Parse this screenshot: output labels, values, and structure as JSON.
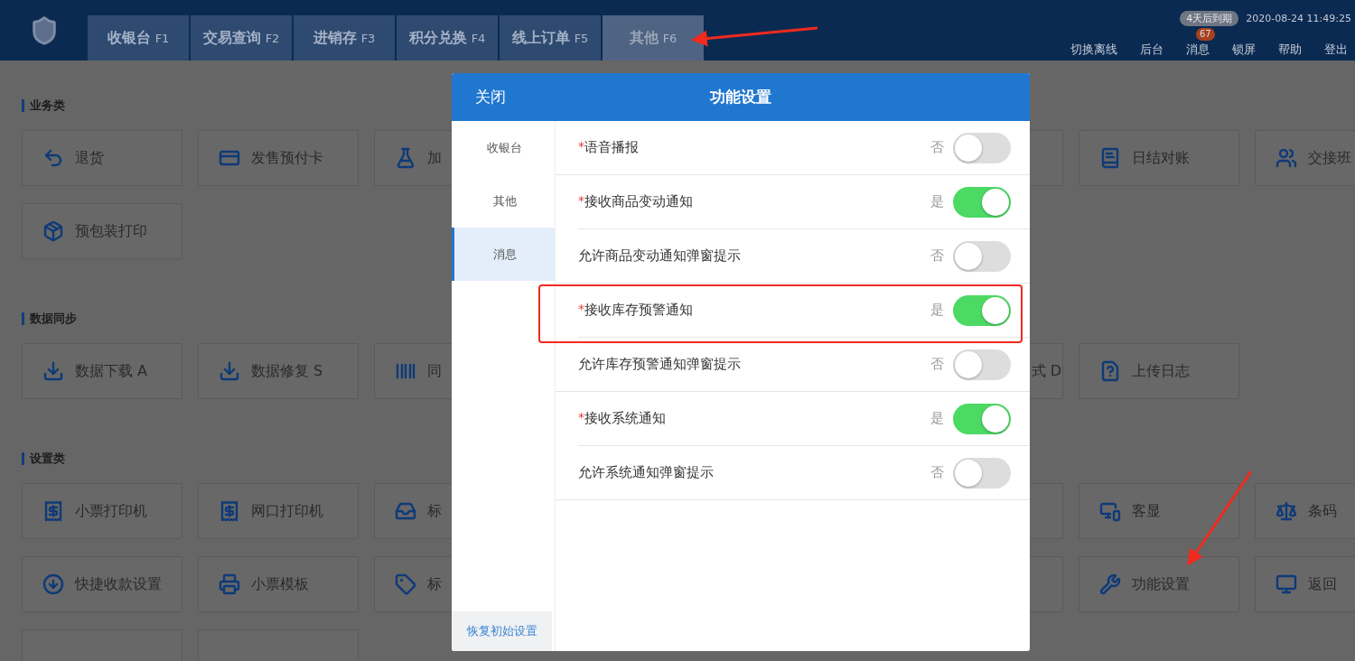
{
  "header": {
    "tabs": [
      {
        "label": "收银台",
        "key": "F1",
        "selected": false
      },
      {
        "label": "交易查询",
        "key": "F2",
        "selected": false
      },
      {
        "label": "进销存",
        "key": "F3",
        "selected": false
      },
      {
        "label": "积分兑换",
        "key": "F4",
        "selected": false
      },
      {
        "label": "线上订单",
        "key": "F5",
        "selected": false
      },
      {
        "label": "其他",
        "key": "F6",
        "selected": true
      }
    ],
    "expiry_badge": "4天后到期",
    "datetime": "2020-08-24 11:49:25",
    "links": [
      {
        "label": "切换离线"
      },
      {
        "label": "后台"
      },
      {
        "label": "消息",
        "badge": "67"
      },
      {
        "label": "锁屏"
      },
      {
        "label": "帮助"
      },
      {
        "label": "登出"
      }
    ]
  },
  "sections": [
    {
      "title": "业务类",
      "rows": [
        {
          "left": [
            {
              "label": "退货"
            },
            {
              "label": "发售预付卡"
            },
            {
              "label": "加"
            }
          ],
          "right": [
            {
              "kind": "blank"
            },
            {
              "label": "日结对账"
            },
            {
              "label": "交接班"
            }
          ]
        },
        {
          "left": [
            {
              "label": "预包装打印"
            }
          ],
          "right": []
        }
      ]
    },
    {
      "title": "数据同步",
      "rows": [
        {
          "left": [
            {
              "label": "数据下载 A"
            },
            {
              "label": "数据修复 S"
            },
            {
              "label": "同"
            }
          ],
          "right": [
            {
              "label": "式 D",
              "kind": "cut"
            },
            {
              "label": "上传日志"
            }
          ]
        }
      ]
    },
    {
      "title": "设置类",
      "rows": [
        {
          "left": [
            {
              "label": "小票打印机"
            },
            {
              "label": "网口打印机"
            },
            {
              "label": "标"
            }
          ],
          "right": [
            {
              "kind": "blank"
            },
            {
              "label": "客显"
            },
            {
              "label": "条码"
            }
          ]
        },
        {
          "left": [
            {
              "label": "快捷收款设置"
            },
            {
              "label": "小票模板"
            },
            {
              "label": "标"
            }
          ],
          "right": [
            {
              "kind": "blank"
            },
            {
              "label": "功能设置"
            },
            {
              "label": "返回"
            }
          ]
        },
        {
          "left": [
            {
              "kind": "blank"
            },
            {
              "kind": "blank"
            }
          ],
          "right": []
        }
      ]
    }
  ],
  "dialog": {
    "close": "关闭",
    "title": "功能设置",
    "nav": [
      {
        "label": "收银台",
        "selected": false
      },
      {
        "label": "其他",
        "selected": false
      },
      {
        "label": "消息",
        "selected": true
      }
    ],
    "reset": "恢复初始设置",
    "groups": [
      [
        {
          "marker": "*",
          "label": "语音播报",
          "value": "否",
          "on": false
        }
      ],
      [
        {
          "marker": "*",
          "label": "接收商品变动通知",
          "value": "是",
          "on": true
        },
        {
          "label": "允许商品变动通知弹窗提示",
          "value": "否",
          "on": false
        }
      ],
      [
        {
          "marker": "*",
          "label": "接收库存预警通知",
          "value": "是",
          "on": true
        },
        {
          "label": "允许库存预警通知弹窗提示",
          "value": "否",
          "on": false
        }
      ],
      [
        {
          "marker": "*",
          "label": "接收系统通知",
          "value": "是",
          "on": true
        },
        {
          "label": "允许系统通知弹窗提示",
          "value": "否",
          "on": false
        }
      ]
    ]
  }
}
